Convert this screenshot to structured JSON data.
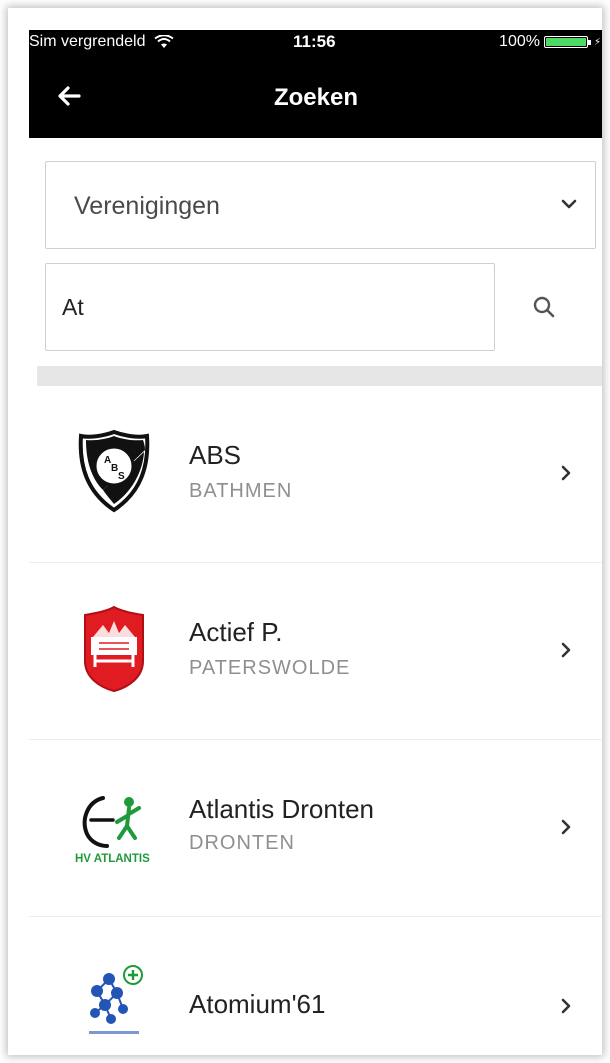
{
  "status_bar": {
    "carrier": "Sim vergrendeld",
    "time": "11:56",
    "battery": "100%",
    "battery_level": 1.0
  },
  "nav": {
    "title": "Zoeken",
    "back_icon": "arrow-left-icon"
  },
  "filter": {
    "selected": "Verenigingen",
    "icon": "chevron-down-icon"
  },
  "search": {
    "value": "At",
    "icon": "search-icon"
  },
  "results": [
    {
      "name": "ABS",
      "city": "BATHMEN",
      "logo": "abs-shield-logo"
    },
    {
      "name": "Actief P.",
      "city": "PATERSWOLDE",
      "logo": "actief-red-shield-logo"
    },
    {
      "name": "Atlantis Dronten",
      "city": "DRONTEN",
      "logo": "hv-atlantis-logo",
      "logo_text": "HV ATLANTIS"
    },
    {
      "name": "Atomium'61",
      "city": "",
      "logo": "atomium-logo"
    }
  ],
  "colors": {
    "topbar": "#000000",
    "battery_fill": "#4cd964",
    "actief_red": "#e11b22",
    "atlantis_green": "#1f9a3a",
    "atomium_blue": "#2255b5"
  }
}
